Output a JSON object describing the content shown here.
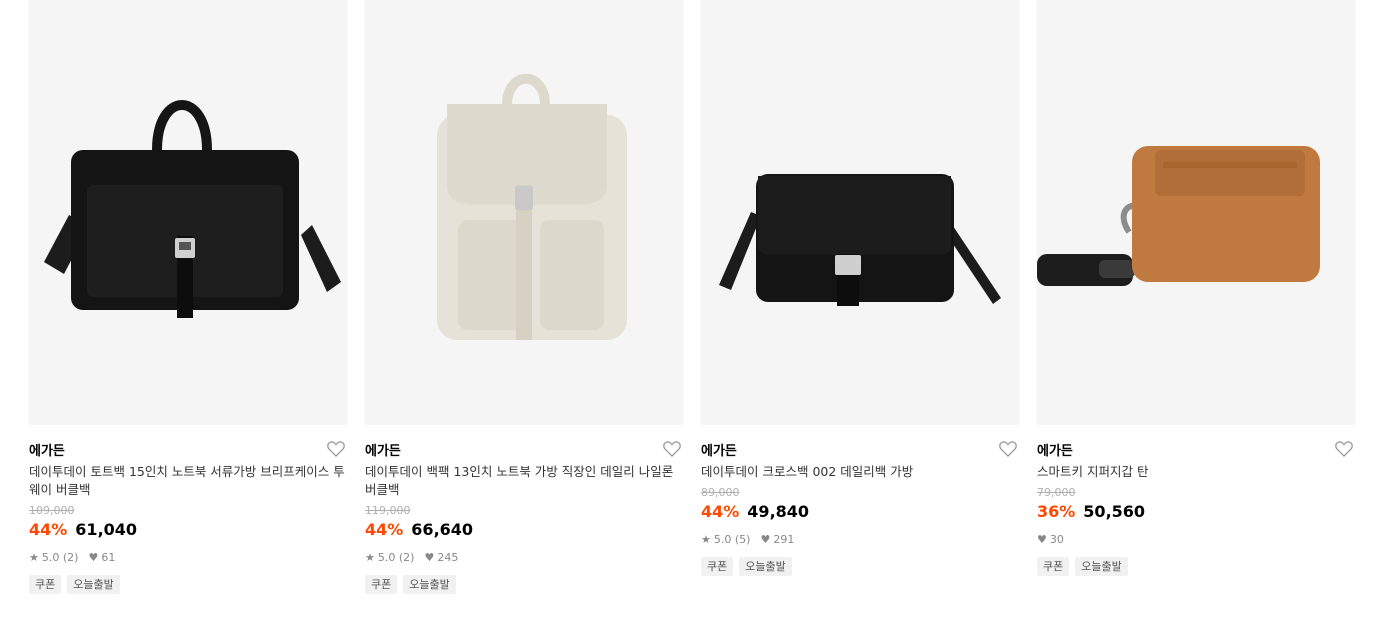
{
  "products": [
    {
      "image_icon": "black-briefcase-laptop-bag-image",
      "brand": "에가든",
      "title": "데이투데이 토트백 15인치 노트북 서류가방 브리프케이스 투웨이 버클백",
      "original_price": "109,000",
      "discount": "44%",
      "price": "61,040",
      "rating": "5.0 (2)",
      "likes": "61",
      "tags": [
        "쿠폰",
        "오늘출발"
      ]
    },
    {
      "image_icon": "cream-backpack-image",
      "brand": "에가든",
      "title": "데이투데이 백팩 13인치 노트북 가방 직장인 데일리 나일론 버클백",
      "original_price": "119,000",
      "discount": "44%",
      "price": "66,640",
      "rating": "5.0 (2)",
      "likes": "245",
      "tags": [
        "쿠폰",
        "오늘출발"
      ]
    },
    {
      "image_icon": "black-crossbody-bag-image",
      "brand": "에가든",
      "title": "데이투데이 크로스백 002 데일리백 가방",
      "original_price": "89,000",
      "discount": "44%",
      "price": "49,840",
      "rating": "5.0 (5)",
      "likes": "291",
      "tags": [
        "쿠폰",
        "오늘출발"
      ]
    },
    {
      "image_icon": "tan-smartkey-zipper-wallet-image",
      "brand": "에가든",
      "title": "스마트키 지퍼지갑 탄",
      "original_price": "79,000",
      "discount": "36%",
      "price": "50,560",
      "rating": "",
      "likes": "30",
      "tags": [
        "쿠폰",
        "오늘출발"
      ]
    }
  ],
  "colors": {
    "discount": "#ff4800",
    "thumb_bg": "#f5f5f5",
    "tag_bg": "#f1f1f1"
  }
}
